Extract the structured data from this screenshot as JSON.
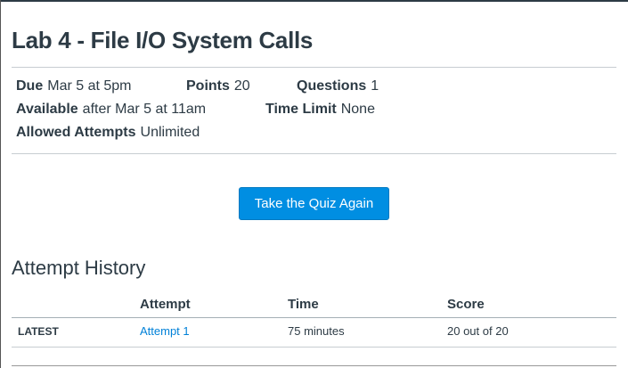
{
  "title": "Lab 4 - File I/O System Calls",
  "details": {
    "due_label": "Due",
    "due": "Mar 5 at 5pm",
    "points_label": "Points",
    "points": "20",
    "questions_label": "Questions",
    "questions": "1",
    "available_label": "Available",
    "available": "after Mar 5 at 11am",
    "time_limit_label": "Time Limit",
    "time_limit": "None",
    "attempts_label": "Allowed Attempts",
    "attempts": "Unlimited"
  },
  "button": "Take the Quiz Again",
  "history": {
    "heading": "Attempt History",
    "columns": [
      "Attempt",
      "Time",
      "Score"
    ],
    "rows": [
      {
        "tag": "LATEST",
        "attempt": "Attempt 1",
        "time": "75 minutes",
        "score": "20 out of 20"
      }
    ]
  }
}
